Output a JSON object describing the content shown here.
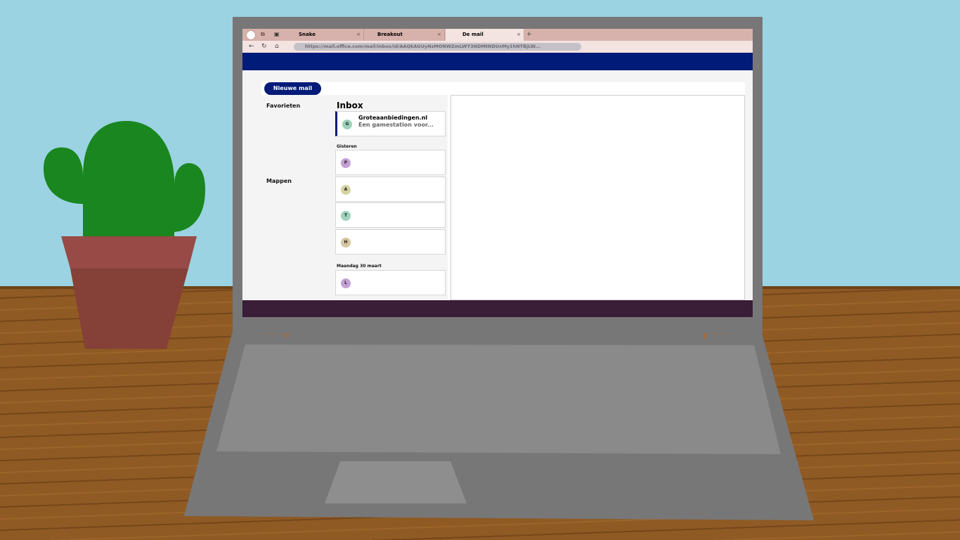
{
  "browser": {
    "tabs": [
      {
        "label": "Snake",
        "close": "×"
      },
      {
        "label": "Breakout",
        "close": "×"
      },
      {
        "label": "De mail",
        "close": "×"
      }
    ],
    "new_tab": "+",
    "nav": {
      "back": "←",
      "reload": "↻",
      "home": "⌂"
    },
    "url": "https://mail.office.com/mail/inbox/id/AAQkAGUyNzMONWZmLWY3NDMtNDUxMy1hNTBjLW..."
  },
  "mail": {
    "new_mail_label": "Nieuwe mail",
    "nav": {
      "favorites": "Favorieten",
      "folders": "Mappen"
    },
    "inbox_title": "Inbox",
    "top_item": {
      "avatar": "G",
      "avatar_color": "#9dd3bb",
      "sender": "Groteaanbiedingen.nl",
      "preview": "Een gamestation voor..."
    },
    "groups": [
      {
        "label": "Gisteren",
        "items": [
          {
            "avatar": "P",
            "avatar_color": "#c5a0d6"
          },
          {
            "avatar": "A",
            "avatar_color": "#d6d2a3"
          },
          {
            "avatar": "T",
            "avatar_color": "#9dd3bb"
          },
          {
            "avatar": "H",
            "avatar_color": "#d6c7a3"
          }
        ]
      },
      {
        "label": "Maandag 30 maart",
        "items": [
          {
            "avatar": "L",
            "avatar_color": "#c5a0d6"
          }
        ]
      }
    ]
  },
  "colors": {
    "brand": "#001b78",
    "footer": "#3a1d37",
    "tab_bar": "#d7b1ab",
    "sky": "#9bd3e2",
    "desk": "#8f5a24"
  }
}
